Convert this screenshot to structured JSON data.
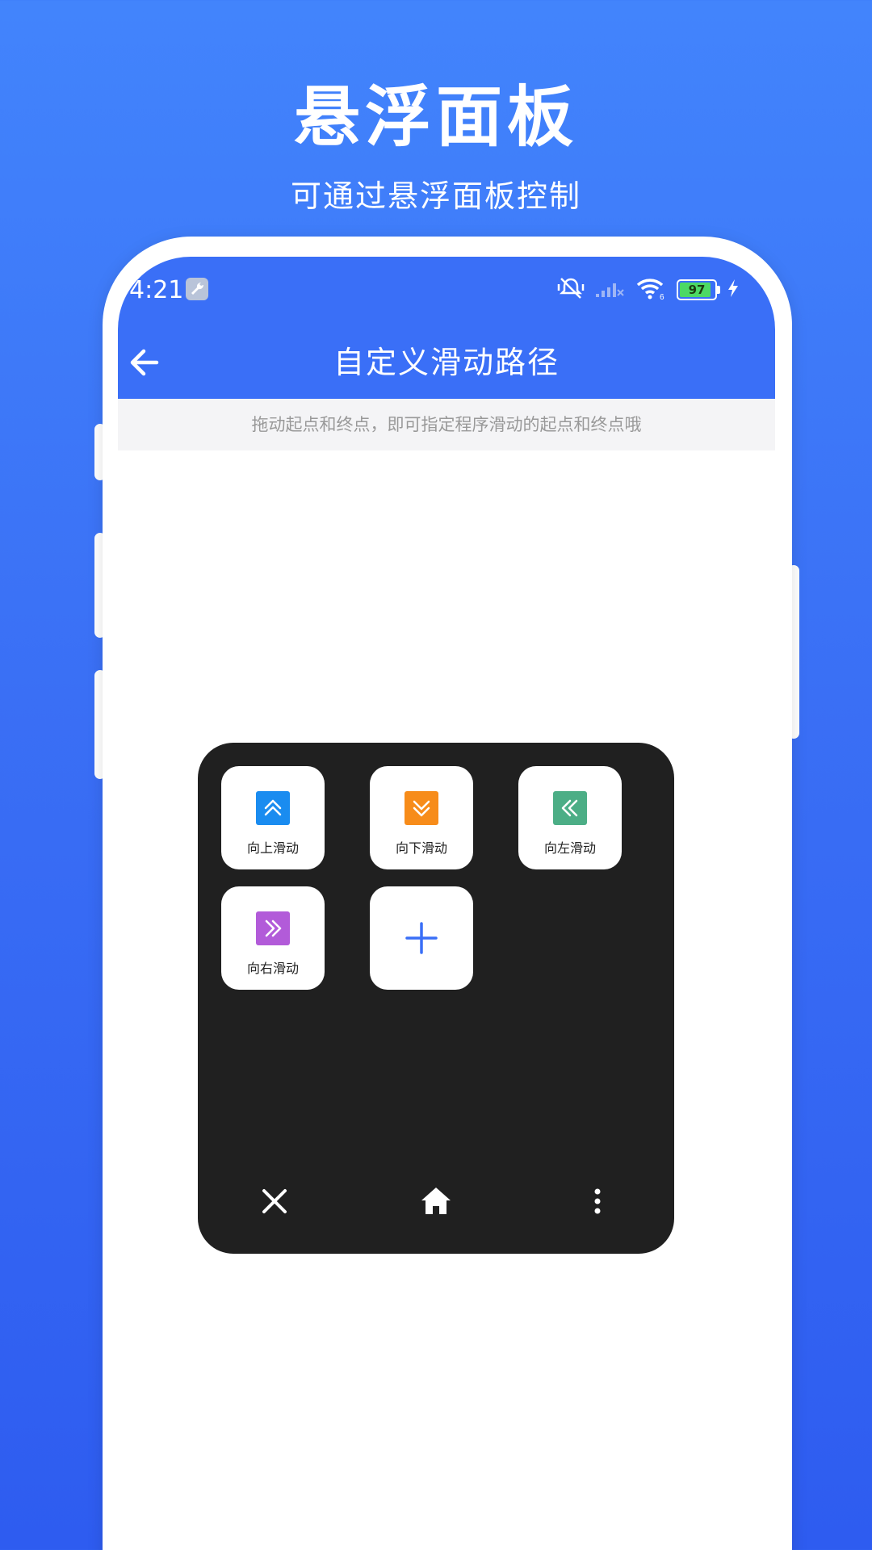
{
  "promo": {
    "title": "悬浮面板",
    "subtitle": "可通过悬浮面板控制"
  },
  "status_bar": {
    "time": "4:21",
    "battery_level": "97",
    "icons": [
      "wrench-icon",
      "mute-vibrate-icon",
      "signal-icon",
      "wifi-icon",
      "battery-icon",
      "charging-icon"
    ]
  },
  "header": {
    "back_icon": "arrow-left-icon",
    "title": "自定义滑动路径"
  },
  "hint": {
    "text": "拖动起点和终点，即可指定程序滑动的起点和终点哦"
  },
  "panel": {
    "tiles": [
      {
        "label": "向上滑动",
        "icon": "double-chevron-up-icon",
        "color": "#1a8cf0"
      },
      {
        "label": "向下滑动",
        "icon": "double-chevron-down-icon",
        "color": "#f78c1a"
      },
      {
        "label": "向左滑动",
        "icon": "double-chevron-left-icon",
        "color": "#4cae86"
      },
      {
        "label": "向右滑动",
        "icon": "double-chevron-right-icon",
        "color": "#b25bd9"
      }
    ],
    "add_icon": "plus-icon",
    "add_color": "#3a6ff7",
    "bottom_icons": [
      "close-icon",
      "home-icon",
      "more-vertical-icon"
    ]
  },
  "colors": {
    "background": "#3a6ff5",
    "accent": "#3a6ff7",
    "panel": "#202020"
  }
}
